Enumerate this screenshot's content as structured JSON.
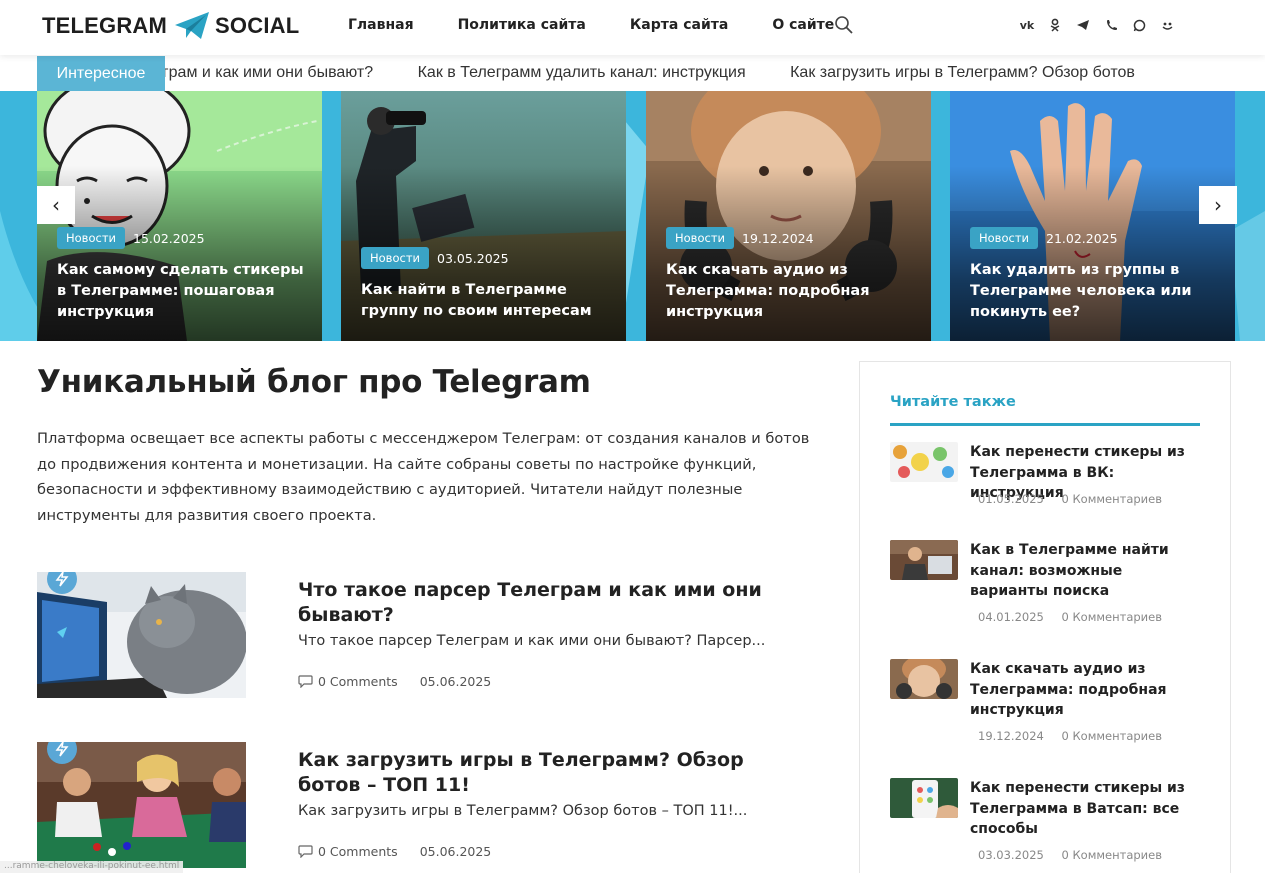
{
  "header": {
    "logo_left": "TELEGRAM",
    "logo_right": "SOCIAL",
    "nav": [
      "Главная",
      "Политика сайта",
      "Карта сайта",
      "О сайте"
    ],
    "social": [
      "vk-icon",
      "odnoklassniki-icon",
      "telegram-icon",
      "viber-icon",
      "whatsapp-icon",
      "mail-icon"
    ]
  },
  "ticker": {
    "label": "Интересное",
    "items": [
      "Что такое парсер Телеграм и как ими они бывают?",
      "Как в Телеграмм удалить канал: инструкция",
      "Как загрузить игры в Телеграмм? Обзор ботов"
    ]
  },
  "slider": {
    "slides": [
      {
        "badge": "Новости",
        "date": "15.02.2025",
        "title": "Как самому сделать стикеры в Телеграмме: пошаговая инструкция"
      },
      {
        "badge": "Новости",
        "date": "03.05.2025",
        "title": "Как найти в Телеграмме группу по своим интересам"
      },
      {
        "badge": "Новости",
        "date": "19.12.2024",
        "title": "Как скачать аудио из Телеграмма: подробная инструкция"
      },
      {
        "badge": "Новости",
        "date": "21.02.2025",
        "title": "Как удалить из группы в Телеграмме человека или покинуть ее?"
      }
    ],
    "prev": "‹",
    "next": "›"
  },
  "main": {
    "title": "Уникальный блог про Telegram",
    "intro": "Платформа освещает все аспекты работы с мессенджером Телеграм: от создания каналов и ботов до продвижения контента и монетизации. На сайте собраны советы по настройке функций, безопасности и эффективному взаимодействию с аудиторией. Читатели найдут полезные инструменты для развития своего проекта.",
    "posts": [
      {
        "title": "Что такое парсер Телеграм и как ими они бывают?",
        "excerpt": "Что такое парсер Телеграм и как ими они бывают? Парсер...",
        "comments": "0 Comments",
        "date": "05.06.2025"
      },
      {
        "title": "Как загрузить игры в Телеграмм? Обзор ботов – ТОП 11!",
        "excerpt": "Как загрузить игры в Телеграмм? Обзор ботов – ТОП 11!...",
        "comments": "0 Comments",
        "date": "05.06.2025"
      }
    ]
  },
  "sidebar": {
    "title": "Читайте также",
    "items": [
      {
        "title": "Как перенести стикеры из Телеграмма в ВК: инструкция",
        "date": "01.05.2025",
        "comments": "0 Комментариев"
      },
      {
        "title": "Как в Телеграмме найти канал: возможные варианты поиска",
        "date": "04.01.2025",
        "comments": "0 Комментариев"
      },
      {
        "title": "Как скачать аудио из Телеграмма: подробная инструкция",
        "date": "19.12.2024",
        "comments": "0 Комментариев"
      },
      {
        "title": "Как перенести стикеры из Телеграмма в Ватсап: все способы",
        "date": "03.03.2025",
        "comments": "0 Комментариев"
      }
    ]
  },
  "status_url": "...ramme-cheloveka-ili-pokinut-ee.html"
}
